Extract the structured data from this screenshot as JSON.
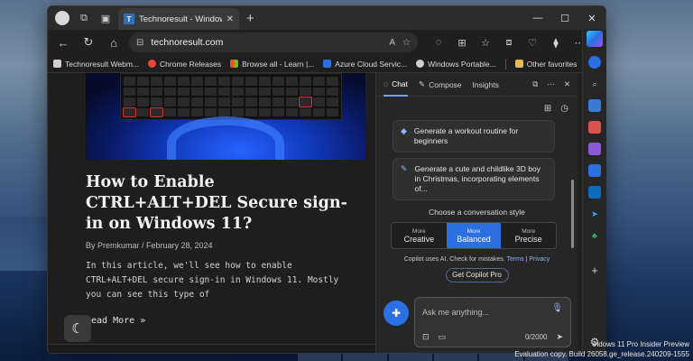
{
  "window": {
    "tab_title": "Technoresult - Windows-HowTo",
    "tab_favicon": "T",
    "controls": [
      "—",
      "☐",
      "✕"
    ]
  },
  "toolbar": {
    "url": "technoresult.com",
    "read_aloud": "A",
    "icons": [
      "star-icon",
      "refresh-copilot-icon",
      "split-screen-icon",
      "favorites-icon",
      "collections-icon",
      "performance-icon",
      "extensions-icon",
      "more-icon"
    ]
  },
  "favorites": {
    "items": [
      {
        "label": "Technoresult Webm...",
        "color": "#cfcfcf"
      },
      {
        "label": "Chrome Releases",
        "color": "#e8453c"
      },
      {
        "label": "Browse all - Learn |...",
        "color": "#f25022"
      },
      {
        "label": "Azure Cloud Servic...",
        "color": "#2b6fe0"
      },
      {
        "label": "Windows Portable...",
        "color": "#cfcfcf"
      }
    ],
    "other": "Other favorites"
  },
  "article": {
    "title": "How to Enable CTRL+ALT+DEL Secure sign-in on Windows 11?",
    "meta": "By Premkumar / February 28, 2024",
    "body": "In this article, we'll see how to enable CTRL+ALT+DEL secure sign-in in Windows 11. Mostly you can see this type of",
    "read_more": "Read More »"
  },
  "copilot": {
    "tabs": {
      "chat": "Chat",
      "compose": "Compose",
      "insights": "Insights"
    },
    "suggestions": [
      "Generate a workout routine for beginners",
      "Generate a cute and childlike 3D boy in Christmas, incorporating elements of..."
    ],
    "style_title": "Choose a conversation style",
    "styles": [
      {
        "prefix": "More",
        "name": "Creative"
      },
      {
        "prefix": "More",
        "name": "Balanced"
      },
      {
        "prefix": "More",
        "name": "Precise"
      }
    ],
    "disclaimer": "Copilot uses AI. Check for mistakes.",
    "terms": "Terms",
    "privacy": "Privacy",
    "pro_button": "Get Copilot Pro",
    "input_placeholder": "Ask me anything...",
    "char_count": "0/2000"
  },
  "watermark": {
    "line1": "indows 11 Pro Insider Preview",
    "line2": "Evaluation copy. Build 26058.ge_release.240209-1555"
  }
}
